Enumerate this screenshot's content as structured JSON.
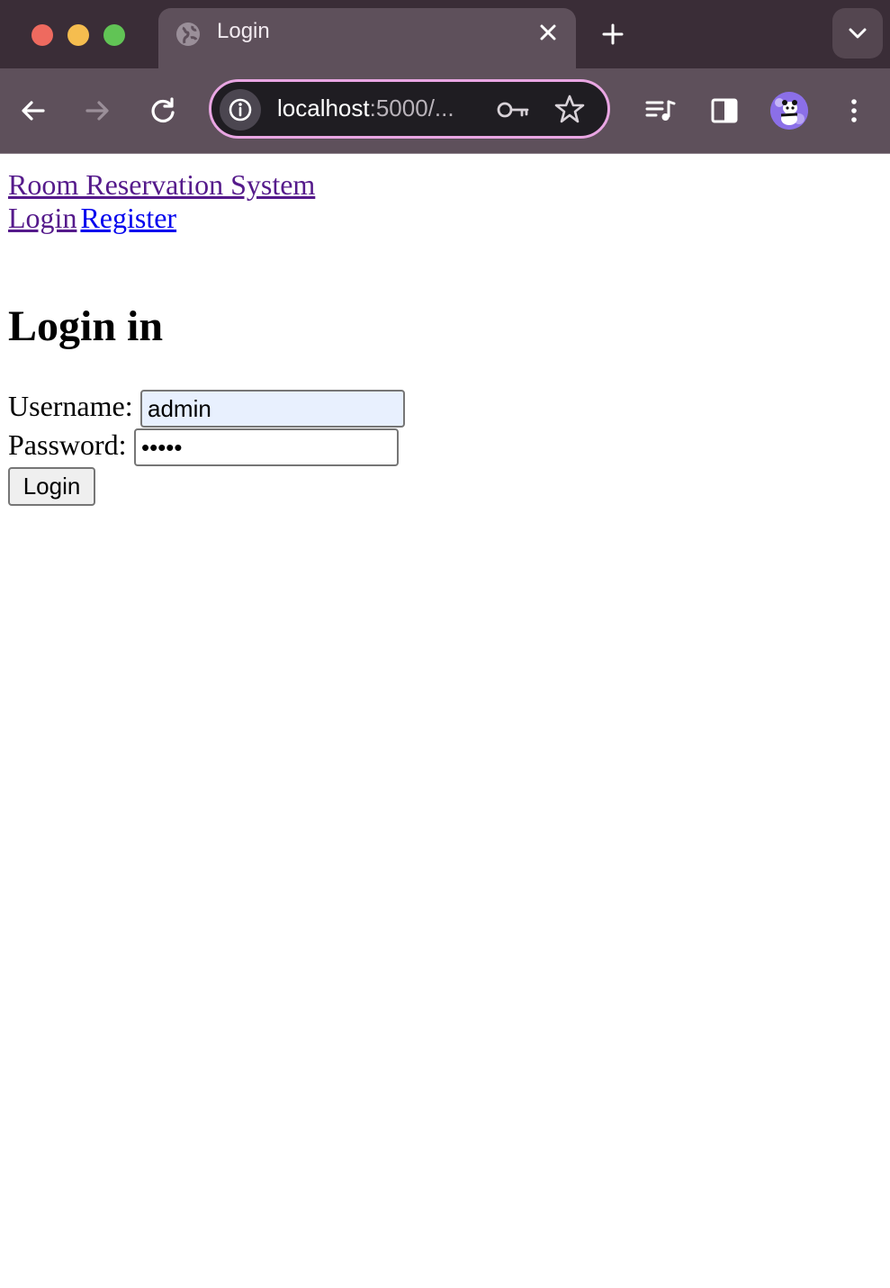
{
  "browser": {
    "tab_title": "Login",
    "url_host": "localhost",
    "url_rest": ":5000/...",
    "omnibox_border_color": "#e9a6e3",
    "icons": [
      "globe-icon",
      "close-icon",
      "new-tab-icon",
      "chevron-down-icon",
      "back-arrow-icon",
      "forward-arrow-icon",
      "reload-icon",
      "info-icon",
      "key-icon",
      "star-icon",
      "media-icon",
      "sidebar-icon",
      "avatar",
      "menu-kebab-icon"
    ]
  },
  "site": {
    "name": "Room Reservation System",
    "nav": {
      "login": "Login",
      "register": "Register"
    }
  },
  "form": {
    "heading": "Login in",
    "username_label": "Username:",
    "username_value": "admin",
    "password_label": "Password:",
    "password_value": "•••••",
    "submit_label": "Login"
  },
  "colors": {
    "link_visited": "#551a8b",
    "link_unvisited": "#0000ee",
    "autofill_bg": "#e8f0fe"
  }
}
